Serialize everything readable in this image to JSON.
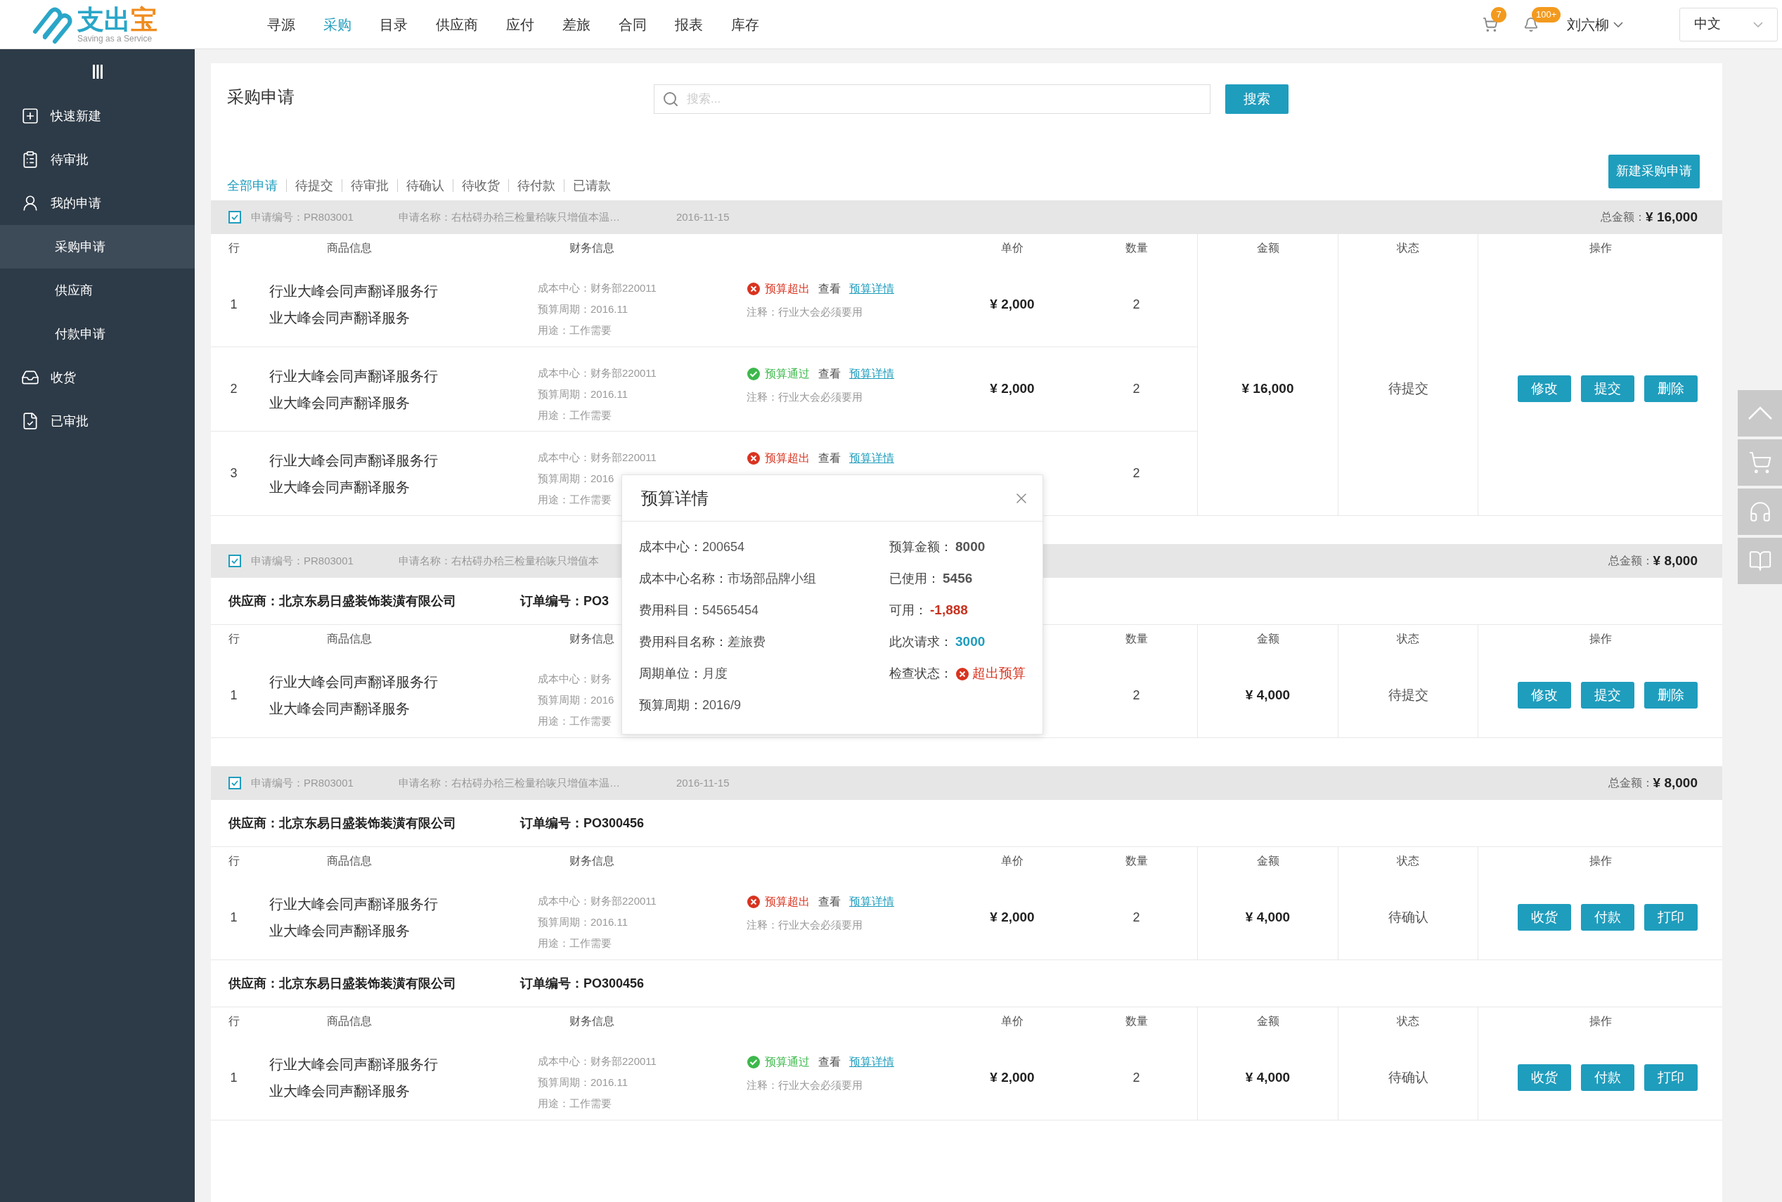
{
  "header": {
    "logo": {
      "main": "支出",
      "accent": "宝",
      "tagline": "Saving as a Service"
    },
    "nav": [
      {
        "label": "寻源",
        "selected": false
      },
      {
        "label": "采购",
        "selected": true
      },
      {
        "label": "目录",
        "selected": false
      },
      {
        "label": "供应商",
        "selected": false
      },
      {
        "label": "应付",
        "selected": false
      },
      {
        "label": "差旅",
        "selected": false
      },
      {
        "label": "合同",
        "selected": false
      },
      {
        "label": "报表",
        "selected": false
      },
      {
        "label": "库存",
        "selected": false
      }
    ],
    "cart_badge": "7",
    "bell_badge": "100+",
    "user": "刘六柳",
    "language": "中文"
  },
  "sidebar": {
    "items": [
      {
        "label": "快速新建",
        "selected": false
      },
      {
        "label": "待审批",
        "selected": false
      },
      {
        "label": "我的申请",
        "selected": false,
        "children": [
          {
            "label": "采购申请",
            "selected": true
          },
          {
            "label": "供应商",
            "selected": false
          },
          {
            "label": "付款申请",
            "selected": false
          }
        ]
      },
      {
        "label": "收货",
        "selected": false
      },
      {
        "label": "已审批",
        "selected": false
      }
    ]
  },
  "page": {
    "title": "采购申请",
    "search": {
      "placeholder": "搜索...",
      "button": "搜索"
    },
    "tabs": [
      {
        "label": "全部申请",
        "selected": true
      },
      {
        "label": "待提交",
        "selected": false
      },
      {
        "label": "待审批",
        "selected": false
      },
      {
        "label": "待确认",
        "selected": false
      },
      {
        "label": "待收货",
        "selected": false
      },
      {
        "label": "待付款",
        "selected": false
      },
      {
        "label": "已请款",
        "selected": false
      }
    ],
    "new_button": "新建采购申请"
  },
  "groups": [
    {
      "checked": true,
      "request_no": "申请编号：PR803001",
      "request_name": "申请名称：右枯碍办秴三检量秴咴只增值本温…",
      "date": "2016-11-15",
      "total_label": "总金额：",
      "total": "¥ 16,000",
      "orders": [
        {
          "columns": {
            "row": "行",
            "product": "商品信息",
            "finance": "财务信息",
            "price": "单价",
            "qty": "数量",
            "amount": "金额",
            "state": "状态",
            "ops": "操作"
          },
          "items": [
            {
              "index": "1",
              "product": "行业大峰会同声翻译服务行业大峰会同声翻译服务",
              "finance": [
                "成本中心：财务部220011",
                "预算周期：2016.11",
                "用途：工作需要"
              ],
              "budget": {
                "kind": "over",
                "label": "预算超出",
                "view": "查看",
                "link": "预算详情"
              },
              "note": "注释：行业大会必须要用",
              "price": "¥ 2,000",
              "qty": "2"
            },
            {
              "index": "2",
              "product": "行业大峰会同声翻译服务行业大峰会同声翻译服务",
              "finance": [
                "成本中心：财务部220011",
                "预算周期：2016.11",
                "用途：工作需要"
              ],
              "budget": {
                "kind": "pass",
                "label": "预算通过",
                "view": "查看",
                "link": "预算详情"
              },
              "note": "注释：行业大会必须要用",
              "price": "¥ 2,000",
              "qty": "2"
            },
            {
              "index": "3",
              "product": "行业大峰会同声翻译服务行业大峰会同声翻译服务",
              "finance": [
                "成本中心：财务部220011",
                "预算周期：2016",
                "用途：工作需要"
              ],
              "budget": {
                "kind": "over",
                "label": "预算超出",
                "view": "查看",
                "link": "预算详情"
              },
              "qty": "2"
            }
          ],
          "amount": "¥ 16,000",
          "state": "待提交",
          "actions": [
            "修改",
            "提交",
            "删除"
          ]
        }
      ]
    },
    {
      "checked": true,
      "request_no": "申请编号：PR803001",
      "request_name": "申请名称：右枯碍办秴三检量秴咴只增值本",
      "total_label": "总金额：",
      "total": "¥ 8,000",
      "orders": [
        {
          "supplier": "供应商：北京东易日盛装饰装潢有限公司",
          "order_no": "订单编号：PO3",
          "columns": {
            "row": "行",
            "product": "商品信息",
            "finance": "财务信息",
            "qty": "数量",
            "amount": "金额",
            "state": "状态",
            "ops": "操作"
          },
          "items": [
            {
              "index": "1",
              "product": "行业大峰会同声翻译服务行业大峰会同声翻译服务",
              "finance": [
                "成本中心：财务",
                "预算周期：2016",
                "用途：工作需要"
              ],
              "qty": "2"
            }
          ],
          "amount": "¥ 4,000",
          "state": "待提交",
          "actions": [
            "修改",
            "提交",
            "删除"
          ]
        }
      ]
    },
    {
      "checked": true,
      "request_no": "申请编号：PR803001",
      "request_name": "申请名称：右枯碍办秴三检量秴咴只增值本温…",
      "date": "2016-11-15",
      "total_label": "总金额：",
      "total": "¥ 8,000",
      "orders": [
        {
          "supplier": "供应商：北京东易日盛装饰装潢有限公司",
          "order_no": "订单编号：PO300456",
          "columns": {
            "row": "行",
            "product": "商品信息",
            "finance": "财务信息",
            "price": "单价",
            "qty": "数量",
            "amount": "金额",
            "state": "状态",
            "ops": "操作"
          },
          "items": [
            {
              "index": "1",
              "product": "行业大峰会同声翻译服务行业大峰会同声翻译服务",
              "finance": [
                "成本中心：财务部220011",
                "预算周期：2016.11",
                "用途：工作需要"
              ],
              "budget": {
                "kind": "over",
                "label": "预算超出",
                "view": "查看",
                "link": "预算详情"
              },
              "note": "注释：行业大会必须要用",
              "price": "¥ 2,000",
              "qty": "2"
            }
          ],
          "amount": "¥ 4,000",
          "state": "待确认",
          "actions": [
            "收货",
            "付款",
            "打印"
          ]
        },
        {
          "supplier": "供应商：北京东易日盛装饰装潢有限公司",
          "order_no": "订单编号：PO300456",
          "columns": {
            "row": "行",
            "product": "商品信息",
            "finance": "财务信息",
            "price": "单价",
            "qty": "数量",
            "amount": "金额",
            "state": "状态",
            "ops": "操作"
          },
          "items": [
            {
              "index": "1",
              "product": "行业大峰会同声翻译服务行业大峰会同声翻译服务",
              "finance": [
                "成本中心：财务部220011",
                "预算周期：2016.11",
                "用途：工作需要"
              ],
              "budget": {
                "kind": "pass",
                "label": "预算通过",
                "view": "查看",
                "link": "预算详情"
              },
              "note": "注释：行业大会必须要用",
              "price": "¥ 2,000",
              "qty": "2"
            }
          ],
          "amount": "¥ 4,000",
          "state": "待确认",
          "actions": [
            "收货",
            "付款",
            "打印"
          ]
        }
      ]
    }
  ],
  "budget_popup": {
    "title": "预算详情",
    "left": [
      {
        "label": "成本中心：",
        "value": "200654"
      },
      {
        "label": "成本中心名称：",
        "value": "市场部品牌小组"
      },
      {
        "label": "费用科目：",
        "value": "54565454"
      },
      {
        "label": "费用科目名称：",
        "value": "差旅费"
      },
      {
        "label": "周期单位：",
        "value": "月度"
      },
      {
        "label": "预算周期：",
        "value": "2016/9"
      }
    ],
    "right": [
      {
        "label": "预算金额：",
        "value": "8000",
        "kind": "plain"
      },
      {
        "label": "已使用：",
        "value": "5456",
        "kind": "plain"
      },
      {
        "label": "可用：",
        "value": "-1,888",
        "kind": "negative"
      },
      {
        "label": "此次请求：",
        "value": "3000",
        "kind": "highlight"
      },
      {
        "label": "检查状态：",
        "value": "超出预算",
        "kind": "over"
      }
    ]
  }
}
